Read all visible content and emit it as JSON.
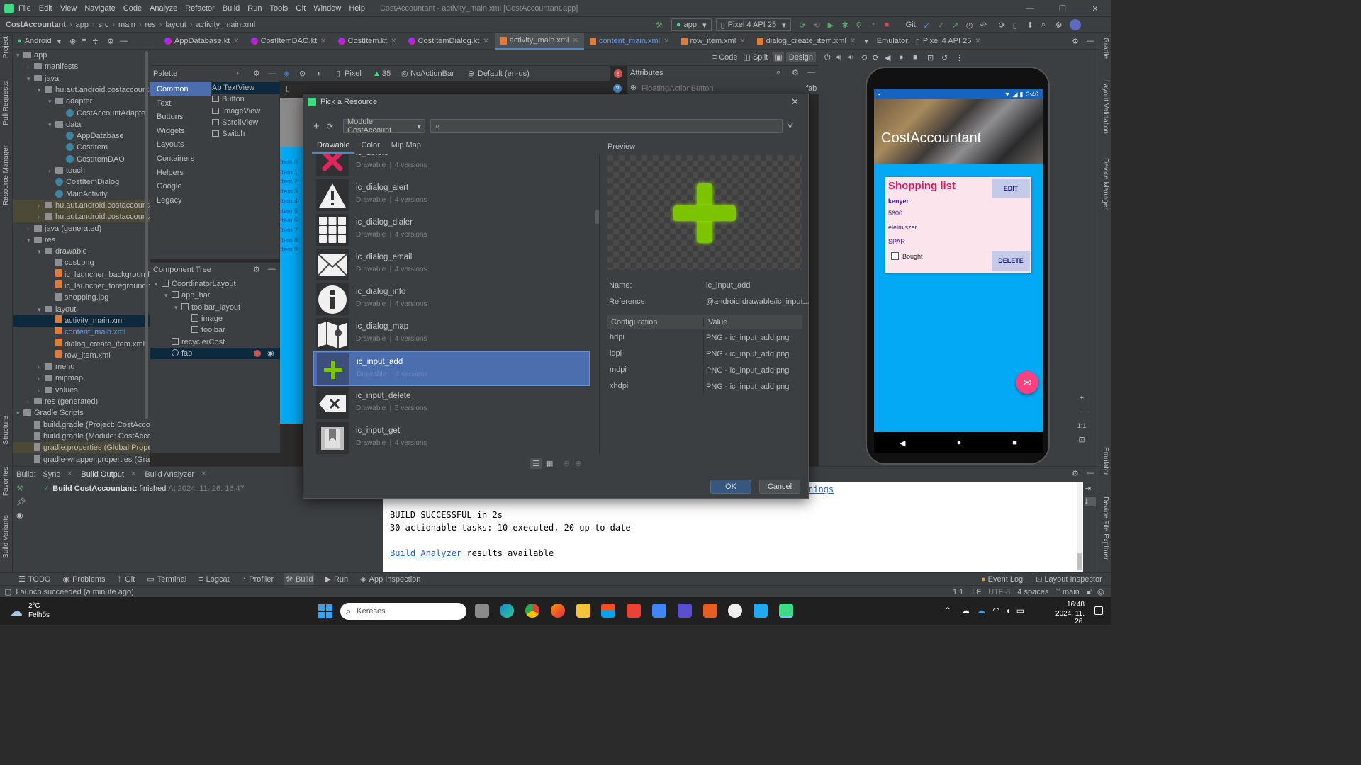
{
  "window": {
    "menu": [
      "File",
      "Edit",
      "View",
      "Navigate",
      "Code",
      "Analyze",
      "Refactor",
      "Build",
      "Run",
      "Tools",
      "Git",
      "Window",
      "Help"
    ],
    "title": "CostAccountant - activity_main.xml [CostAccountant.app]"
  },
  "navbar": {
    "breadcrumb": [
      "CostAccountant",
      "app",
      "src",
      "main",
      "res",
      "layout",
      "activity_main.xml"
    ],
    "run_config": "app",
    "device": "Pixel 4 API 25",
    "git_label": "Git:"
  },
  "tabs": {
    "view_selector": "Android",
    "files": [
      "AppDatabase.kt",
      "CostItemDAO.kt",
      "CostItem.kt",
      "CostItemDialog.kt",
      "activity_main.xml",
      "content_main.xml",
      "row_item.xml",
      "dialog_create_item.xml"
    ],
    "emulator_label": "Emulator:",
    "emulator_device": "Pixel 4 API 25"
  },
  "leftstripe": [
    "Project",
    "Pull Requests",
    "Resource Manager",
    "Structure",
    "Favorites",
    "Build Variants"
  ],
  "rightstripe": [
    "Gradle",
    "Layout Validation",
    "Device Manager",
    "Emulator",
    "Device File Explorer"
  ],
  "project_tree": [
    {
      "label": "app",
      "indent": 0,
      "kind": "folder",
      "expanded": true
    },
    {
      "label": "manifests",
      "indent": 1,
      "kind": "folder"
    },
    {
      "label": "java",
      "indent": 1,
      "kind": "folder",
      "expanded": true
    },
    {
      "label": "hu.aut.android.costaccountan",
      "indent": 2,
      "kind": "folder",
      "expanded": true
    },
    {
      "label": "adapter",
      "indent": 3,
      "kind": "folder",
      "expanded": true
    },
    {
      "label": "CostAccountAdapter",
      "indent": 4,
      "kind": "class"
    },
    {
      "label": "data",
      "indent": 3,
      "kind": "folder",
      "expanded": true
    },
    {
      "label": "AppDatabase",
      "indent": 4,
      "kind": "class"
    },
    {
      "label": "CostItem",
      "indent": 4,
      "kind": "class"
    },
    {
      "label": "CostItemDAO",
      "indent": 4,
      "kind": "class"
    },
    {
      "label": "touch",
      "indent": 3,
      "kind": "folder"
    },
    {
      "label": "CostItemDialog",
      "indent": 3,
      "kind": "class"
    },
    {
      "label": "MainActivity",
      "indent": 3,
      "kind": "class"
    },
    {
      "label": "hu.aut.android.costaccountan",
      "indent": 2,
      "kind": "folder",
      "hl": true
    },
    {
      "label": "hu.aut.android.costaccountan",
      "indent": 2,
      "kind": "folder",
      "hl": true
    },
    {
      "label": "java (generated)",
      "indent": 1,
      "kind": "folder"
    },
    {
      "label": "res",
      "indent": 1,
      "kind": "folder",
      "expanded": true
    },
    {
      "label": "drawable",
      "indent": 2,
      "kind": "folder",
      "expanded": true
    },
    {
      "label": "cost.png",
      "indent": 3,
      "kind": "file"
    },
    {
      "label": "ic_launcher_background.x",
      "indent": 3,
      "kind": "xml"
    },
    {
      "label": "ic_launcher_foreground.x",
      "indent": 3,
      "kind": "xml"
    },
    {
      "label": "shopping.jpg",
      "indent": 3,
      "kind": "file"
    },
    {
      "label": "layout",
      "indent": 2,
      "kind": "folder",
      "expanded": true
    },
    {
      "label": "activity_main.xml",
      "indent": 3,
      "kind": "xml",
      "selected": true
    },
    {
      "label": "content_main.xml",
      "indent": 3,
      "kind": "xml",
      "blue": true
    },
    {
      "label": "dialog_create_item.xml",
      "indent": 3,
      "kind": "xml"
    },
    {
      "label": "row_item.xml",
      "indent": 3,
      "kind": "xml"
    },
    {
      "label": "menu",
      "indent": 2,
      "kind": "folder"
    },
    {
      "label": "mipmap",
      "indent": 2,
      "kind": "folder"
    },
    {
      "label": "values",
      "indent": 2,
      "kind": "folder"
    },
    {
      "label": "res (generated)",
      "indent": 1,
      "kind": "folder"
    },
    {
      "label": "Gradle Scripts",
      "indent": 0,
      "kind": "folder",
      "expanded": true
    },
    {
      "label": "build.gradle (Project: CostAccour",
      "indent": 1,
      "kind": "gradle"
    },
    {
      "label": "build.gradle (Module: CostAcco",
      "indent": 1,
      "kind": "gradle"
    },
    {
      "label": "gradle.properties (Global Properti",
      "indent": 1,
      "kind": "gradle",
      "hl": true
    },
    {
      "label": "gradle-wrapper.properties (Gradl",
      "indent": 1,
      "kind": "gradle"
    }
  ],
  "design_toolbar": {
    "modes": [
      "Code",
      "Split",
      "Design"
    ],
    "device": "Pixel",
    "api": "35",
    "theme": "NoActionBar",
    "locale": "Default (en-us)"
  },
  "palette": {
    "title": "Palette",
    "categories": [
      "Common",
      "Text",
      "Buttons",
      "Widgets",
      "Layouts",
      "Containers",
      "Helpers",
      "Google",
      "Legacy"
    ],
    "items": [
      "Ab TextView",
      "Button",
      "ImageView",
      "ScrollView",
      "Switch"
    ]
  },
  "component_tree": {
    "title": "Component Tree",
    "nodes": [
      {
        "label": "CoordinatorLayout",
        "indent": 0
      },
      {
        "label": "app_bar",
        "indent": 1
      },
      {
        "label": "toolbar_layout",
        "indent": 2
      },
      {
        "label": "image",
        "indent": 3
      },
      {
        "label": "toolbar",
        "indent": 3
      },
      {
        "label": "recyclerCost",
        "indent": 1
      },
      {
        "label": "fab",
        "indent": 1,
        "selected": true
      }
    ]
  },
  "canvas_items": [
    "Item 0",
    "Item 1",
    "Item 2",
    "Item 3",
    "Item 4",
    "Item 5",
    "Item 6",
    "Item 7",
    "Item 8",
    "Item 9"
  ],
  "attributes": {
    "title": "Attributes",
    "component": "FloatingActionButton",
    "id": "fab"
  },
  "dialog": {
    "title": "Pick a Resource",
    "module": "Module: CostAccount",
    "tabs": [
      "Drawable",
      "Color",
      "Mip Map"
    ],
    "resources": [
      {
        "name": "ic_delete",
        "sub": "Drawable",
        "versions": "4 versions",
        "icon": "delete"
      },
      {
        "name": "ic_dialog_alert",
        "sub": "Drawable",
        "versions": "4 versions",
        "icon": "alert"
      },
      {
        "name": "ic_dialog_dialer",
        "sub": "Drawable",
        "versions": "4 versions",
        "icon": "dialer"
      },
      {
        "name": "ic_dialog_email",
        "sub": "Drawable",
        "versions": "4 versions",
        "icon": "email"
      },
      {
        "name": "ic_dialog_info",
        "sub": "Drawable",
        "versions": "4 versions",
        "icon": "info"
      },
      {
        "name": "ic_dialog_map",
        "sub": "Drawable",
        "versions": "4 versions",
        "icon": "map"
      },
      {
        "name": "ic_input_add",
        "sub": "Drawable",
        "versions": "4 versions",
        "icon": "add",
        "selected": true
      },
      {
        "name": "ic_input_delete",
        "sub": "Drawable",
        "versions": "5 versions",
        "icon": "backspace"
      },
      {
        "name": "ic_input_get",
        "sub": "Drawable",
        "versions": "4 versions",
        "icon": "get"
      }
    ],
    "preview_label": "Preview",
    "name_label": "Name:",
    "name_value": "ic_input_add",
    "reference_label": "Reference:",
    "reference_value": "@android:drawable/ic_input...",
    "config_header": "Configuration",
    "value_header": "Value",
    "configs": [
      {
        "config": "hdpi",
        "value": "PNG - ic_input_add.png"
      },
      {
        "config": "ldpi",
        "value": "PNG - ic_input_add.png"
      },
      {
        "config": "mdpi",
        "value": "PNG - ic_input_add.png"
      },
      {
        "config": "xhdpi",
        "value": "PNG - ic_input_add.png"
      }
    ],
    "ok_label": "OK",
    "cancel_label": "Cancel"
  },
  "phone": {
    "time": "3:46",
    "app_title": "CostAccountant",
    "card": {
      "title": "Shopping list",
      "name": "kenyer",
      "price": "5600",
      "category": "elelmiszer",
      "shop": "SPAR",
      "bought_label": "Bought",
      "edit_label": "EDIT",
      "delete_label": "DELETE"
    },
    "zoom_label": "1:1"
  },
  "build_panel": {
    "label": "Build:",
    "tabs": [
      "Sync",
      "Build Output",
      "Build Analyzer"
    ],
    "status_title": "Build CostAccountant:",
    "status_text": "finished",
    "status_time": "At 2024. 11. 26. 16:47",
    "console_link_tail": "nings",
    "console_lines": [
      "BUILD SUCCESSFUL in 2s",
      "30 actionable tasks: 10 executed, 20 up-to-date"
    ],
    "analyzer_link": "Build Analyzer",
    "analyzer_rest": " results available"
  },
  "bottom_tools": [
    "TODO",
    "Problems",
    "Git",
    "Terminal",
    "Logcat",
    "Profiler",
    "Build",
    "Run",
    "App Inspection"
  ],
  "bottom_right_tools": [
    "Event Log",
    "Layout Inspector"
  ],
  "status": {
    "message": "Launch succeeded (a minute ago)",
    "pos": "1:1",
    "lf": "LF",
    "encoding": "UTF-8",
    "indent": "4 spaces",
    "branch": "main"
  },
  "taskbar": {
    "weather_temp": "2°C",
    "weather_desc": "Felhős",
    "search_placeholder": "Keresés",
    "time": "16:48",
    "date": "2024. 11. 26."
  },
  "colors": {
    "accent_blue": "#4a88c7",
    "selection": "#4b6eaf",
    "phone_blue": "#03a9f4",
    "fab_pink": "#ff4081",
    "card_title": "#d81b60",
    "plus_green": "#7cc400"
  }
}
